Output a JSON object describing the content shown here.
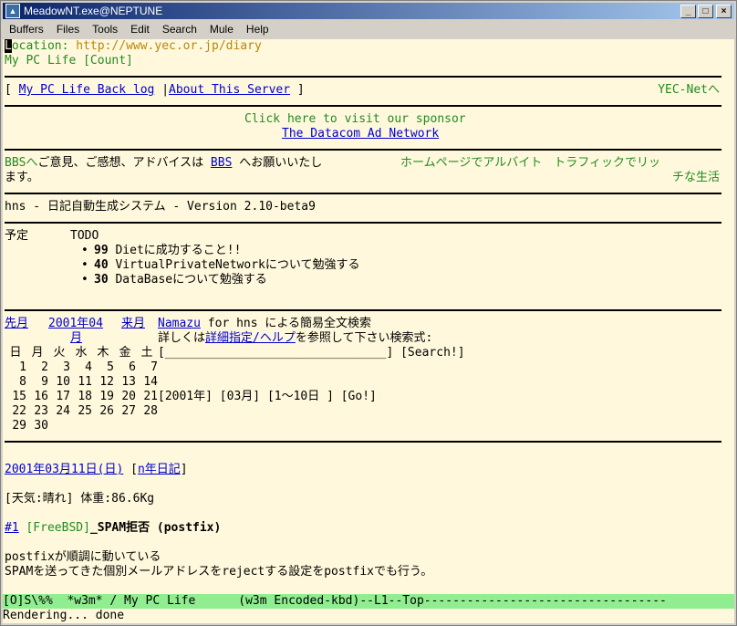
{
  "window": {
    "title": "MeadowNT.exe@NEPTUNE"
  },
  "menu": [
    "Buffers",
    "Files",
    "Tools",
    "Edit",
    "Search",
    "Mule",
    "Help"
  ],
  "header": {
    "location_label": "Location:",
    "location_url": "http://www.yec.or.jp/diary",
    "subtitle": "My PC Life [Count]"
  },
  "nav": {
    "open": "[ ",
    "backlog": "My PC Life Back log",
    "sep": " |",
    "about": "About This Server",
    "close": " ]",
    "yecnet": "YEC-Netへ"
  },
  "sponsor": {
    "text": "Click here to visit our sponsor",
    "link": "The Datacom Ad Network"
  },
  "bbs": {
    "prefix": "BBSへ",
    "text1": "ご意見、ご感想、アドバイスは ",
    "bbs_link": "BBS",
    "text2": " へお願いいたし",
    "text3": "ます。",
    "right1": "ホームページでアルバイト　トラフィックでリッ",
    "right2": "チな生活"
  },
  "hns": {
    "title": "hns - 日記自動生成システム - Version 2.10-beta9"
  },
  "todo": {
    "label": "予定",
    "heading": "TODO",
    "items": [
      {
        "priority": "99",
        "text": "Dietに成功すること!!"
      },
      {
        "priority": "40",
        "text": "VirtualPrivateNetworkについて勉強する"
      },
      {
        "priority": "30",
        "text": "DataBaseについて勉強する"
      }
    ]
  },
  "calendar": {
    "prev": "先月",
    "month": "2001年04",
    "month2": "月",
    "next": "来月",
    "weekdays": [
      "日",
      "月",
      "火",
      "水",
      "木",
      "金",
      "土"
    ],
    "weeks": [
      [
        "1",
        "2",
        "3",
        "4",
        "5",
        "6",
        "7"
      ],
      [
        "8",
        "9",
        "10",
        "11",
        "12",
        "13",
        "14"
      ],
      [
        "15",
        "16",
        "17",
        "18",
        "19",
        "20",
        "21"
      ],
      [
        "22",
        "23",
        "24",
        "25",
        "26",
        "27",
        "28"
      ],
      [
        "29",
        "30",
        "",
        "",
        "",
        "",
        ""
      ]
    ]
  },
  "search": {
    "namazu": "Namazu",
    "line1_rest": " for hns による簡易全文検索",
    "line2_pre": "詳しくは",
    "detail_link": "詳細指定/ヘルプ",
    "line2_post": "を参照して下さい検索式:",
    "input_field": "[_______________________________]",
    "search_button": "[Search!]",
    "year": "[2001年]",
    "month": "[03月]",
    "range": "[1～10日 ]",
    "go": "[Go!]"
  },
  "entry": {
    "date": "2001年03月11日(日)",
    "nyear": "n年日記",
    "weather": "[天気:晴れ] 体重:86.6Kg",
    "anchor": "#1",
    "category": "[FreeBSD]",
    "heading": "_SPAM拒否 (postfix)",
    "body1": "postfixが順調に動いている",
    "body2": "SPAMを送ってきた個別メールアドレスをrejectする設定をpostfixでも行う。"
  },
  "modeline": "[O]S\\%%  *w3m* / My PC Life      (w3m Encoded-kbd)--L1--Top----------------------------------",
  "minibuffer": "Rendering... done",
  "colors": {
    "background": "#fff8dc",
    "green_text": "#228b22",
    "url_text": "#b8860b",
    "link": "#0000cd",
    "modeline": "#90ee90"
  }
}
